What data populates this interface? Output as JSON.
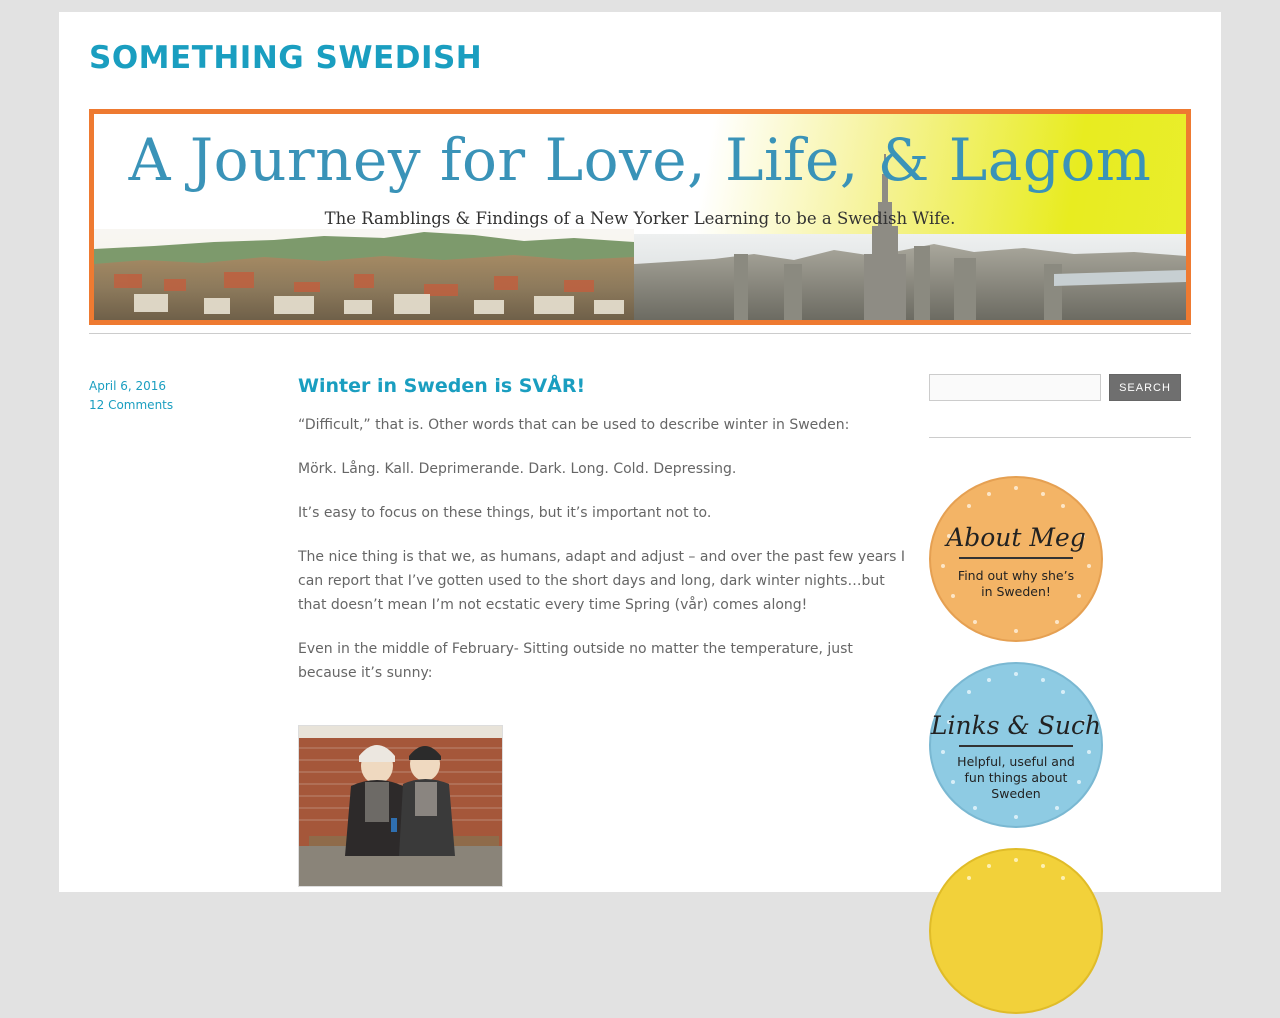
{
  "site": {
    "title": "SOMETHING SWEDISH"
  },
  "banner": {
    "headline": "A Journey for Love, Life, & Lagom",
    "tagline": "The Ramblings & Findings of a New Yorker Learning to be a Swedish Wife."
  },
  "post": {
    "date": "April 6, 2016",
    "comments": "12 Comments",
    "title": "Winter in Sweden is SVÅR!",
    "paragraphs": [
      "“Difficult,” that is. Other words that can be used to describe winter in Sweden:",
      "Mörk. Lång. Kall. Deprimerande. Dark. Long. Cold. Depressing.",
      "It’s easy to focus on these things, but it’s important not to.",
      "The nice thing is that we, as humans, adapt and adjust – and over the past few years I can report that I’ve gotten used to the short days and long, dark winter nights…but that doesn’t mean I’m not ecstatic every time Spring (vår) comes along!",
      "Even in the middle of February- Sitting outside no matter the temperature, just because it’s sunny:"
    ]
  },
  "sidebar": {
    "search_button": "SEARCH",
    "search_placeholder": "",
    "badges": [
      {
        "title": "About Meg",
        "line1": "Find out why she’s",
        "line2": "in Sweden!",
        "line3": "",
        "color": "#f3b466"
      },
      {
        "title": "Links & Such",
        "line1": "Helpful, useful and",
        "line2": "fun things about",
        "line3": "Sweden",
        "color": "#8ecbe3"
      },
      {
        "title": "",
        "line1": "",
        "line2": "",
        "line3": "",
        "color": "#f2d13a"
      }
    ]
  },
  "colors": {
    "accent": "#1a9ec0",
    "banner_border": "#ee7a31",
    "background": "#e2e2e2"
  }
}
